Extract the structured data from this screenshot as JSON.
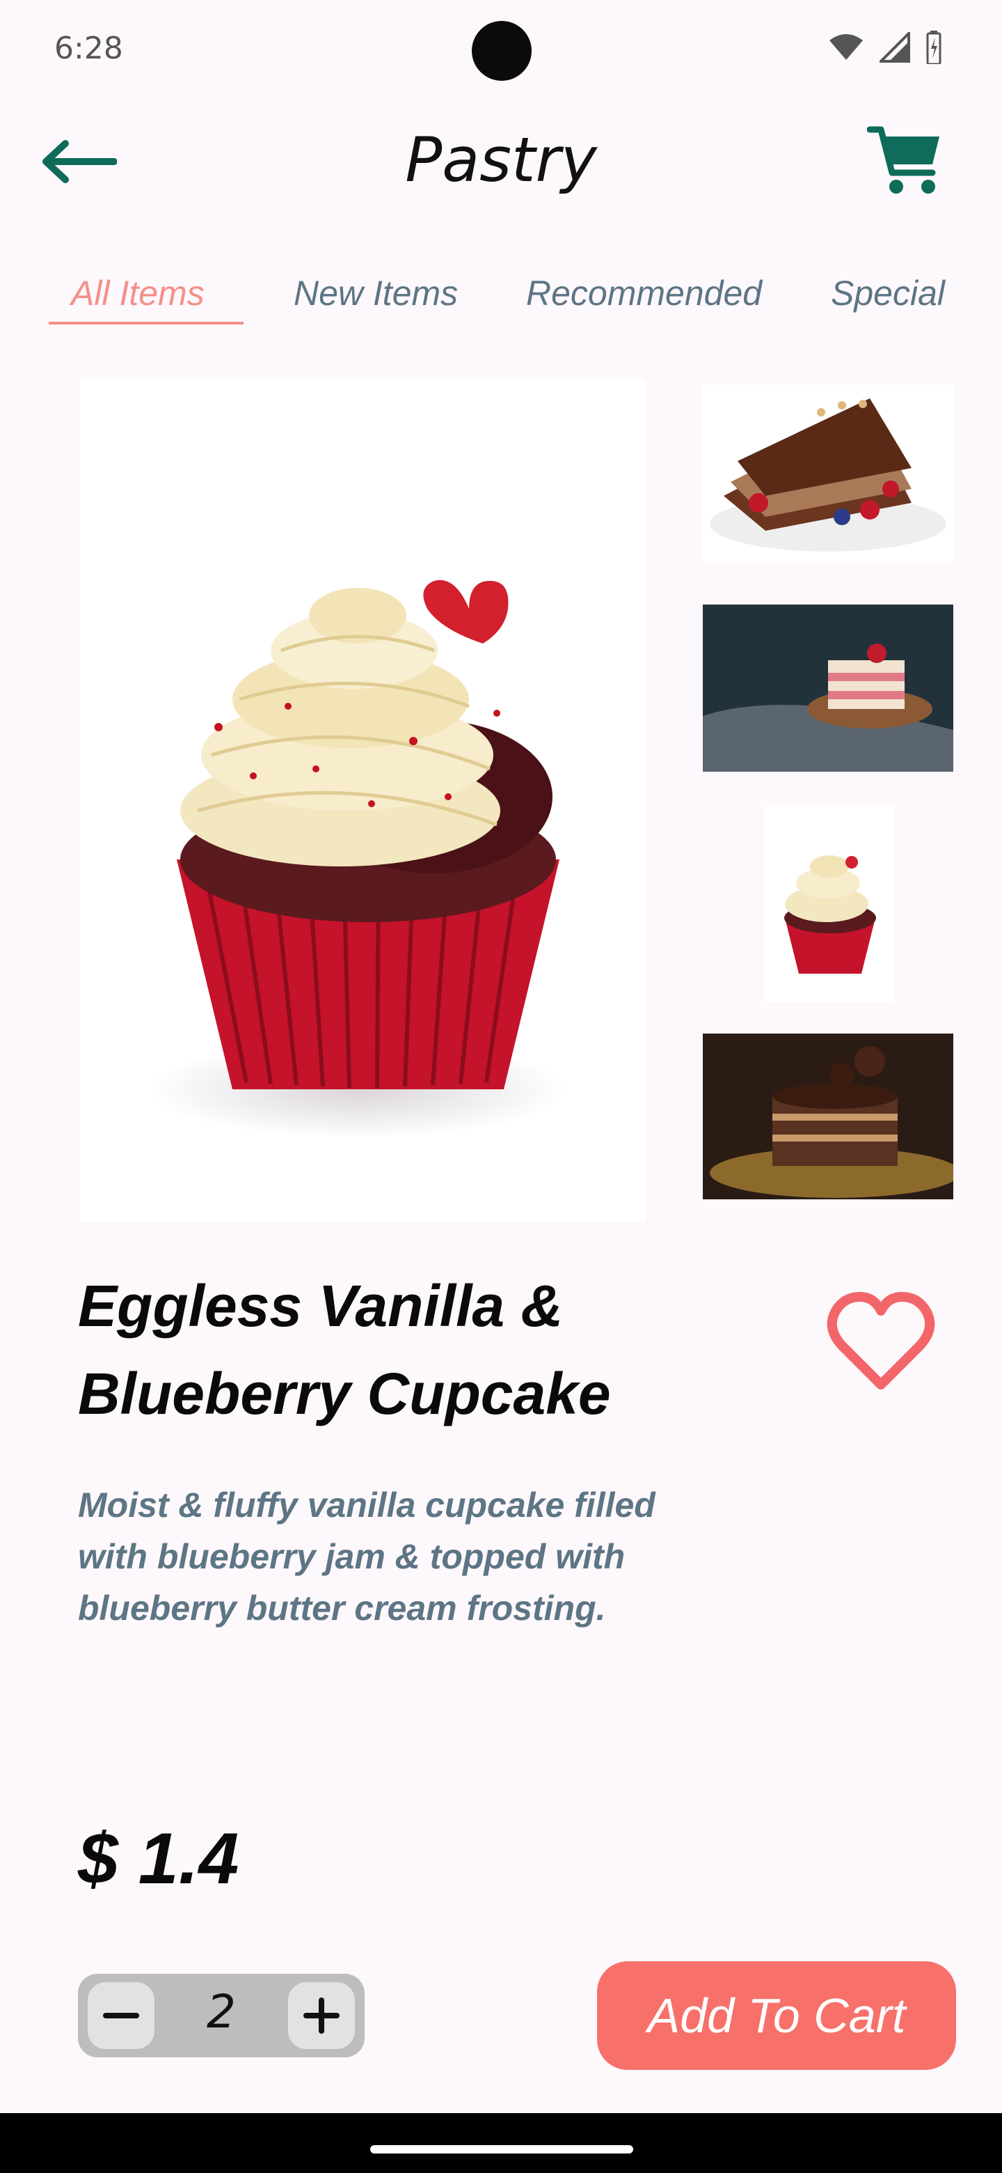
{
  "status_bar": {
    "time": "6:28",
    "icons": [
      "wifi-icon",
      "signal-icon",
      "battery-icon"
    ]
  },
  "header": {
    "title": "Pastry",
    "back_icon": "arrow-left-icon",
    "cart_icon": "shopping-cart-icon",
    "accent_color": "#0f6b5a"
  },
  "tabs": [
    {
      "label": "All Items",
      "active": true
    },
    {
      "label": "New Items",
      "active": false
    },
    {
      "label": "Recommended",
      "active": false
    },
    {
      "label": "Special",
      "active": false
    }
  ],
  "gallery": {
    "main_image": "red-velvet-cupcake-image",
    "thumbnails": [
      "chocolate-cake-slice-image",
      "layered-berry-cake-image",
      "cupcake-thumbnail-image",
      "chocolate-layer-cake-image"
    ]
  },
  "product": {
    "name": "Eggless Vanilla & Blueberry Cupcake",
    "description": "Moist & fluffy vanilla cupcake filled with blueberry jam & topped with blueberry butter cream frosting.",
    "price": "$ 1.4",
    "favorite_icon": "heart-outline-icon"
  },
  "cart": {
    "quantity": "2",
    "add_label": "Add To Cart",
    "button_color": "#f8706a"
  }
}
